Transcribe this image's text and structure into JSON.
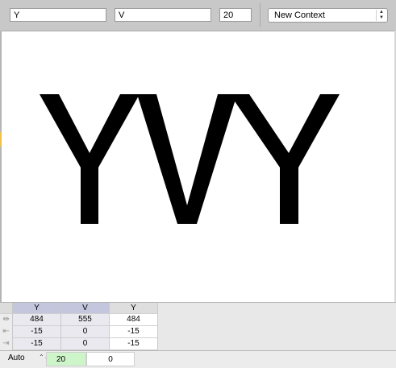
{
  "toolbar": {
    "left_glyph": "Y",
    "right_glyph": "V",
    "size": "20",
    "context_select": "New Context"
  },
  "preview": {
    "glyphs": [
      "Y",
      "V",
      "Y"
    ]
  },
  "kern_table": {
    "columns": [
      "Y",
      "V",
      "Y"
    ],
    "rows": [
      {
        "icon": "double-arrow-icon",
        "values": [
          "484",
          "555",
          "484"
        ]
      },
      {
        "icon": "left-arrow-icon",
        "values": [
          "-15",
          "0",
          "-15"
        ]
      },
      {
        "icon": "right-arrow-icon",
        "values": [
          "-15",
          "0",
          "-15"
        ]
      }
    ]
  },
  "footer": {
    "mode": "Auto",
    "value_a": "20",
    "value_b": "0"
  },
  "colors": {
    "toolbar_bg": "#c8c8c8",
    "header_highlight": "#c3c6dc",
    "active_value": "#cdf5c9",
    "left_marker": "#f0c14b"
  }
}
